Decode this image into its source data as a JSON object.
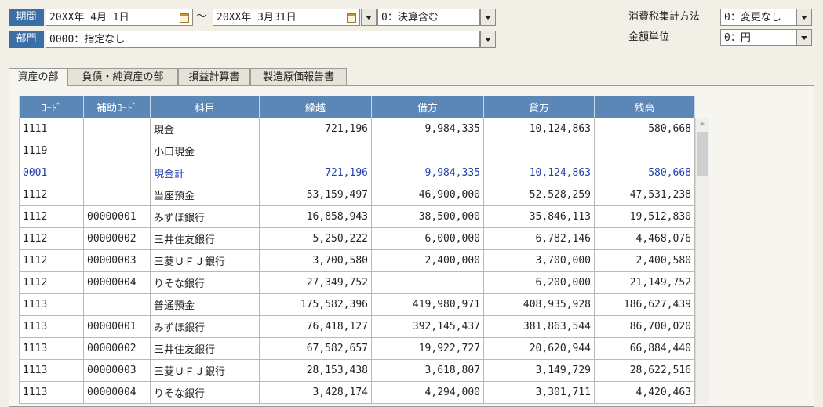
{
  "filters": {
    "period_label": "期間",
    "start_date": "20XX年 4月 1日",
    "range_sep": "～",
    "end_date": "20XX年 3月31日",
    "settlement": "0：決算含む",
    "dept_label": "部門",
    "dept_value": "0000：指定なし",
    "tax_label": "消費税集計方法",
    "tax_value": "0：変更なし",
    "unit_label": "金額単位",
    "unit_value": "0：円"
  },
  "tabs": [
    {
      "label": "資産の部",
      "active": true
    },
    {
      "label": "負債・純資産の部",
      "active": false
    },
    {
      "label": "損益計算書",
      "active": false
    },
    {
      "label": "製造原価報告書",
      "active": false
    }
  ],
  "table": {
    "headers": [
      "ｺｰﾄﾞ",
      "補助ｺｰﾄﾞ",
      "科目",
      "繰越",
      "借方",
      "貸方",
      "残高"
    ],
    "rows": [
      {
        "code": "1111",
        "sub": "",
        "name": "現金",
        "carry": "721,196",
        "debit": "9,984,335",
        "credit": "10,124,863",
        "balance": "580,668",
        "subtotal": false
      },
      {
        "code": "1119",
        "sub": "",
        "name": "小口現金",
        "carry": "",
        "debit": "",
        "credit": "",
        "balance": "",
        "subtotal": false
      },
      {
        "code": "0001",
        "sub": "",
        "name": "現金計",
        "carry": "721,196",
        "debit": "9,984,335",
        "credit": "10,124,863",
        "balance": "580,668",
        "subtotal": true
      },
      {
        "code": "1112",
        "sub": "",
        "name": "当座預金",
        "carry": "53,159,497",
        "debit": "46,900,000",
        "credit": "52,528,259",
        "balance": "47,531,238",
        "subtotal": false
      },
      {
        "code": "1112",
        "sub": "00000001",
        "name": "みずほ銀行",
        "carry": "16,858,943",
        "debit": "38,500,000",
        "credit": "35,846,113",
        "balance": "19,512,830",
        "subtotal": false
      },
      {
        "code": "1112",
        "sub": "00000002",
        "name": "三井住友銀行",
        "carry": "5,250,222",
        "debit": "6,000,000",
        "credit": "6,782,146",
        "balance": "4,468,076",
        "subtotal": false
      },
      {
        "code": "1112",
        "sub": "00000003",
        "name": "三菱ＵＦＪ銀行",
        "carry": "3,700,580",
        "debit": "2,400,000",
        "credit": "3,700,000",
        "balance": "2,400,580",
        "subtotal": false
      },
      {
        "code": "1112",
        "sub": "00000004",
        "name": "りそな銀行",
        "carry": "27,349,752",
        "debit": "",
        "credit": "6,200,000",
        "balance": "21,149,752",
        "subtotal": false
      },
      {
        "code": "1113",
        "sub": "",
        "name": "普通預金",
        "carry": "175,582,396",
        "debit": "419,980,971",
        "credit": "408,935,928",
        "balance": "186,627,439",
        "subtotal": false
      },
      {
        "code": "1113",
        "sub": "00000001",
        "name": "みずほ銀行",
        "carry": "76,418,127",
        "debit": "392,145,437",
        "credit": "381,863,544",
        "balance": "86,700,020",
        "subtotal": false
      },
      {
        "code": "1113",
        "sub": "00000002",
        "name": "三井住友銀行",
        "carry": "67,582,657",
        "debit": "19,922,727",
        "credit": "20,620,944",
        "balance": "66,884,440",
        "subtotal": false
      },
      {
        "code": "1113",
        "sub": "00000003",
        "name": "三菱ＵＦＪ銀行",
        "carry": "28,153,438",
        "debit": "3,618,807",
        "credit": "3,149,729",
        "balance": "28,622,516",
        "subtotal": false
      },
      {
        "code": "1113",
        "sub": "00000004",
        "name": "りそな銀行",
        "carry": "3,428,174",
        "debit": "4,294,000",
        "credit": "3,301,711",
        "balance": "4,420,463",
        "subtotal": false
      }
    ]
  }
}
